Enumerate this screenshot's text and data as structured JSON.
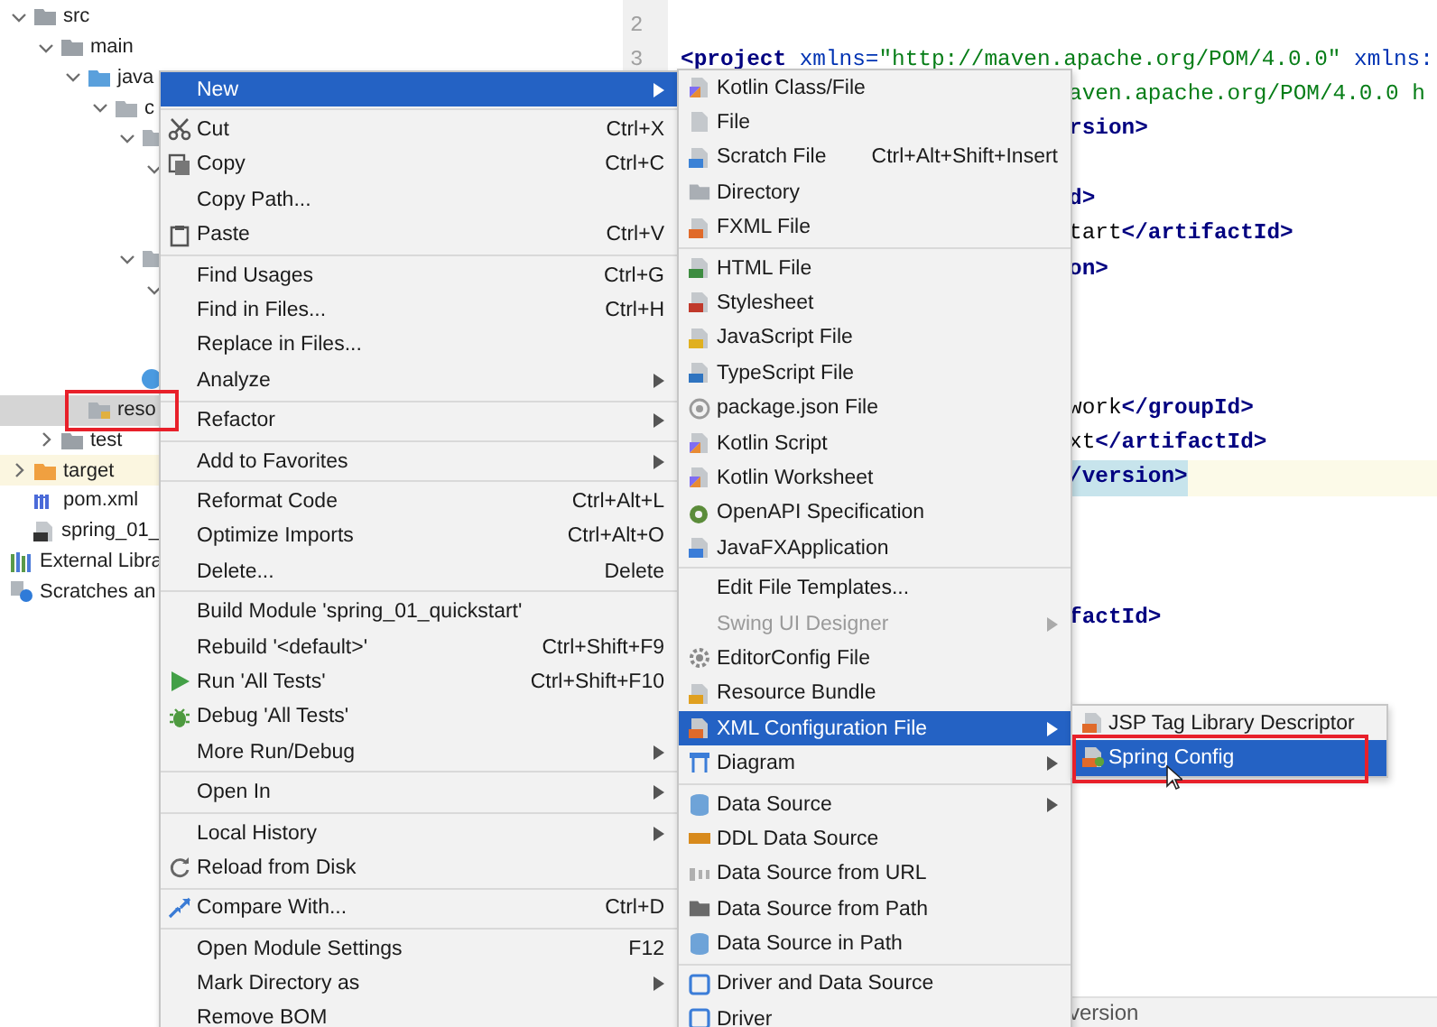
{
  "project_tree": [
    {
      "label": "src",
      "kind": "folder",
      "expanded": true,
      "selected": false,
      "highlighted": false,
      "children": [
        {
          "label": "main",
          "kind": "folder",
          "expanded": true,
          "selected": false,
          "highlighted": false,
          "children": [
            {
              "label": "java",
              "kind": "source-folder",
              "expanded": true,
              "selected": false,
              "highlighted": false,
              "children": [
                {
                  "label": "c",
                  "kind": "package",
                  "expanded": true,
                  "selected": false,
                  "highlighted": false,
                  "children": [
                    {
                      "kind": "package",
                      "expanded": true,
                      "selected": false,
                      "highlighted": false,
                      "children": [
                        {
                          "expanded": true,
                          "selected": false,
                          "highlighted": false,
                          "children": [
                            {
                              "selected": false,
                              "highlighted": false
                            },
                            {
                              "selected": false,
                              "highlighted": false
                            }
                          ]
                        }
                      ]
                    },
                    {
                      "kind": "package",
                      "expanded": true,
                      "selected": false,
                      "highlighted": false,
                      "children": [
                        {
                          "expanded": true,
                          "selected": false,
                          "highlighted": false,
                          "children": [
                            {
                              "selected": false,
                              "highlighted": false
                            },
                            {
                              "selected": false,
                              "highlighted": false
                            }
                          ]
                        }
                      ]
                    },
                    {
                      "kind": "class",
                      "selected": false,
                      "highlighted": false
                    }
                  ]
                }
              ]
            },
            {
              "label": "reso",
              "kind": "resource-folder",
              "selected": true,
              "highlighted": false
            }
          ]
        },
        {
          "label": "test",
          "kind": "folder",
          "expanded": false,
          "selected": false,
          "highlighted": false
        }
      ]
    },
    {
      "label": "target",
      "kind": "excluded-folder",
      "expanded": false,
      "selected": false,
      "highlighted": true
    },
    {
      "label": "pom.xml",
      "kind": "maven-file",
      "selected": false,
      "highlighted": false
    },
    {
      "label": "spring_01_",
      "kind": "module-file",
      "selected": false,
      "highlighted": false
    },
    {
      "label": "External Libra",
      "kind": "libraries",
      "selected": false,
      "highlighted": false
    },
    {
      "label": "Scratches an",
      "kind": "scratches",
      "selected": false,
      "highlighted": false
    }
  ],
  "editor": {
    "lines": [
      {
        "number": "2",
        "current": false,
        "kind": "blank"
      },
      {
        "number": "3",
        "current": false,
        "kind": "full",
        "segments": [
          {
            "text": "<project",
            "kind": "tag"
          },
          {
            "text": " xmlns=",
            "kind": "attr"
          },
          {
            "text": "\"http://maven.apache.org/POM/4.0.0\"",
            "kind": "string"
          },
          {
            "text": " xmlns:",
            "kind": "attr"
          }
        ]
      },
      {
        "current": false,
        "kind": "fragment",
        "segments": [
          {
            "text": "aven.apache.org/POM/4.0.0 h",
            "kind": "string"
          }
        ]
      },
      {
        "current": false,
        "kind": "fragment",
        "segments": [
          {
            "text": "rsion>",
            "kind": "tag"
          }
        ]
      },
      {
        "current": false,
        "kind": "blank"
      },
      {
        "current": false,
        "kind": "fragment",
        "segments": [
          {
            "text": "d>",
            "kind": "tag"
          }
        ]
      },
      {
        "current": false,
        "kind": "fragment",
        "segments": [
          {
            "text": "tart",
            "kind": "text"
          },
          {
            "text": "</artifactId>",
            "kind": "tag"
          }
        ]
      },
      {
        "current": false,
        "kind": "fragment",
        "segments": [
          {
            "text": "on>",
            "kind": "tag"
          }
        ]
      },
      {
        "current": false,
        "kind": "blank"
      },
      {
        "current": false,
        "kind": "blank"
      },
      {
        "current": false,
        "kind": "blank"
      },
      {
        "current": false,
        "kind": "fragment",
        "segments": [
          {
            "text": "work",
            "kind": "text"
          },
          {
            "text": "</groupId>",
            "kind": "tag"
          }
        ]
      },
      {
        "current": false,
        "kind": "fragment",
        "segments": [
          {
            "text": "xt",
            "kind": "text"
          },
          {
            "text": "</artifactId>",
            "kind": "tag"
          }
        ]
      },
      {
        "current": true,
        "kind": "fragment",
        "segments": [
          {
            "text": "/version>",
            "kind": "tag",
            "highlighted": true
          }
        ]
      },
      {
        "current": false,
        "kind": "blank"
      },
      {
        "current": false,
        "kind": "blank"
      },
      {
        "current": false,
        "kind": "blank"
      },
      {
        "current": false,
        "kind": "fragment",
        "segments": [
          {
            "text": "factId>",
            "kind": "tag"
          }
        ]
      }
    ],
    "breadcrumb": "version"
  },
  "context_menu": {
    "items": [
      {
        "kind": "item",
        "label": "New",
        "submenu": true,
        "selected": true
      },
      {
        "kind": "separator"
      },
      {
        "kind": "item",
        "label": "Cut",
        "shortcut": "Ctrl+X",
        "selected": false
      },
      {
        "kind": "item",
        "label": "Copy",
        "shortcut": "Ctrl+C",
        "selected": false
      },
      {
        "kind": "item",
        "label": "Copy Path...",
        "selected": false
      },
      {
        "kind": "item",
        "label": "Paste",
        "shortcut": "Ctrl+V",
        "selected": false
      },
      {
        "kind": "separator"
      },
      {
        "kind": "item",
        "label": "Find Usages",
        "shortcut": "Ctrl+G",
        "selected": false
      },
      {
        "kind": "item",
        "label": "Find in Files...",
        "shortcut": "Ctrl+H",
        "selected": false
      },
      {
        "kind": "item",
        "label": "Replace in Files...",
        "selected": false
      },
      {
        "kind": "item",
        "label": "Analyze",
        "submenu": true,
        "selected": false
      },
      {
        "kind": "separator"
      },
      {
        "kind": "item",
        "label": "Refactor",
        "submenu": true,
        "selected": false
      },
      {
        "kind": "separator"
      },
      {
        "kind": "item",
        "label": "Add to Favorites",
        "submenu": true,
        "selected": false
      },
      {
        "kind": "separator"
      },
      {
        "kind": "item",
        "label": "Reformat Code",
        "shortcut": "Ctrl+Alt+L",
        "selected": false
      },
      {
        "kind": "item",
        "label": "Optimize Imports",
        "shortcut": "Ctrl+Alt+O",
        "selected": false
      },
      {
        "kind": "item",
        "label": "Delete...",
        "shortcut": "Delete",
        "selected": false
      },
      {
        "kind": "separator"
      },
      {
        "kind": "item",
        "label": "Build Module 'spring_01_quickstart'",
        "selected": false
      },
      {
        "kind": "item",
        "label": "Rebuild '<default>'",
        "shortcut": "Ctrl+Shift+F9",
        "selected": false
      },
      {
        "kind": "item",
        "label": "Run 'All Tests'",
        "shortcut": "Ctrl+Shift+F10",
        "selected": false
      },
      {
        "kind": "item",
        "label": "Debug 'All Tests'",
        "selected": false
      },
      {
        "kind": "item",
        "label": "More Run/Debug",
        "submenu": true,
        "selected": false
      },
      {
        "kind": "separator"
      },
      {
        "kind": "item",
        "label": "Open In",
        "submenu": true,
        "selected": false
      },
      {
        "kind": "separator"
      },
      {
        "kind": "item",
        "label": "Local History",
        "submenu": true,
        "selected": false
      },
      {
        "kind": "item",
        "label": "Reload from Disk",
        "selected": false
      },
      {
        "kind": "separator"
      },
      {
        "kind": "item",
        "label": "Compare With...",
        "shortcut": "Ctrl+D",
        "selected": false
      },
      {
        "kind": "separator"
      },
      {
        "kind": "item",
        "label": "Open Module Settings",
        "shortcut": "F12",
        "selected": false
      },
      {
        "kind": "item",
        "label": "Mark Directory as",
        "submenu": true,
        "selected": false
      },
      {
        "kind": "item",
        "label": "Remove BOM",
        "selected": false
      }
    ]
  },
  "new_submenu": {
    "items": [
      {
        "kind": "item",
        "label": "Kotlin Class/File",
        "selected": false
      },
      {
        "kind": "item",
        "label": "File",
        "selected": false
      },
      {
        "kind": "item",
        "label": "Scratch File",
        "shortcut": "Ctrl+Alt+Shift+Insert",
        "selected": false
      },
      {
        "kind": "item",
        "label": "Directory",
        "selected": false
      },
      {
        "kind": "item",
        "label": "FXML File",
        "selected": false
      },
      {
        "kind": "separator"
      },
      {
        "kind": "item",
        "label": "HTML File",
        "selected": false
      },
      {
        "kind": "item",
        "label": "Stylesheet",
        "selected": false
      },
      {
        "kind": "item",
        "label": "JavaScript File",
        "selected": false
      },
      {
        "kind": "item",
        "label": "TypeScript File",
        "selected": false
      },
      {
        "kind": "item",
        "label": "package.json File",
        "selected": false
      },
      {
        "kind": "item",
        "label": "Kotlin Script",
        "selected": false
      },
      {
        "kind": "item",
        "label": "Kotlin Worksheet",
        "selected": false
      },
      {
        "kind": "item",
        "label": "OpenAPI Specification",
        "selected": false
      },
      {
        "kind": "item",
        "label": "JavaFXApplication",
        "selected": false
      },
      {
        "kind": "separator"
      },
      {
        "kind": "item",
        "label": "Edit File Templates...",
        "selected": false
      },
      {
        "kind": "item",
        "label": "Swing UI Designer",
        "submenu": true,
        "disabled": true,
        "selected": false
      },
      {
        "kind": "item",
        "label": "EditorConfig File",
        "selected": false
      },
      {
        "kind": "item",
        "label": "Resource Bundle",
        "selected": false
      },
      {
        "kind": "item",
        "label": "XML Configuration File",
        "submenu": true,
        "selected": true
      },
      {
        "kind": "item",
        "label": "Diagram",
        "submenu": true,
        "selected": false
      },
      {
        "kind": "separator"
      },
      {
        "kind": "item",
        "label": "Data Source",
        "submenu": true,
        "selected": false
      },
      {
        "kind": "item",
        "label": "DDL Data Source",
        "selected": false
      },
      {
        "kind": "item",
        "label": "Data Source from URL",
        "selected": false
      },
      {
        "kind": "item",
        "label": "Data Source from Path",
        "selected": false
      },
      {
        "kind": "item",
        "label": "Data Source in Path",
        "selected": false
      },
      {
        "kind": "separator"
      },
      {
        "kind": "item",
        "label": "Driver and Data Source",
        "selected": false
      },
      {
        "kind": "item",
        "label": "Driver",
        "selected": false
      }
    ]
  },
  "xml_submenu": {
    "items": [
      {
        "kind": "item",
        "label": "JSP Tag Library Descriptor",
        "selected": false
      },
      {
        "kind": "item",
        "label": "Spring Config",
        "selected": true
      }
    ]
  }
}
